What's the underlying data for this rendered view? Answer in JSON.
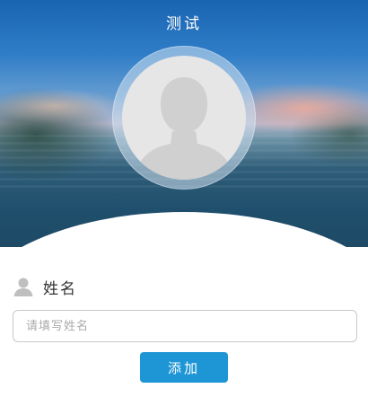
{
  "header": {
    "title": "测试"
  },
  "avatar": {
    "icon": "default-user-avatar-icon"
  },
  "form": {
    "name_label": "姓名",
    "name_icon": "person-icon",
    "name_placeholder": "请填写姓名",
    "name_value": "",
    "submit_label": "添加"
  },
  "colors": {
    "accent": "#1e96d6",
    "input_border": "#c9c9c9",
    "avatar_bg": "#e6e6e6",
    "avatar_silhouette": "#d0d0d0"
  }
}
